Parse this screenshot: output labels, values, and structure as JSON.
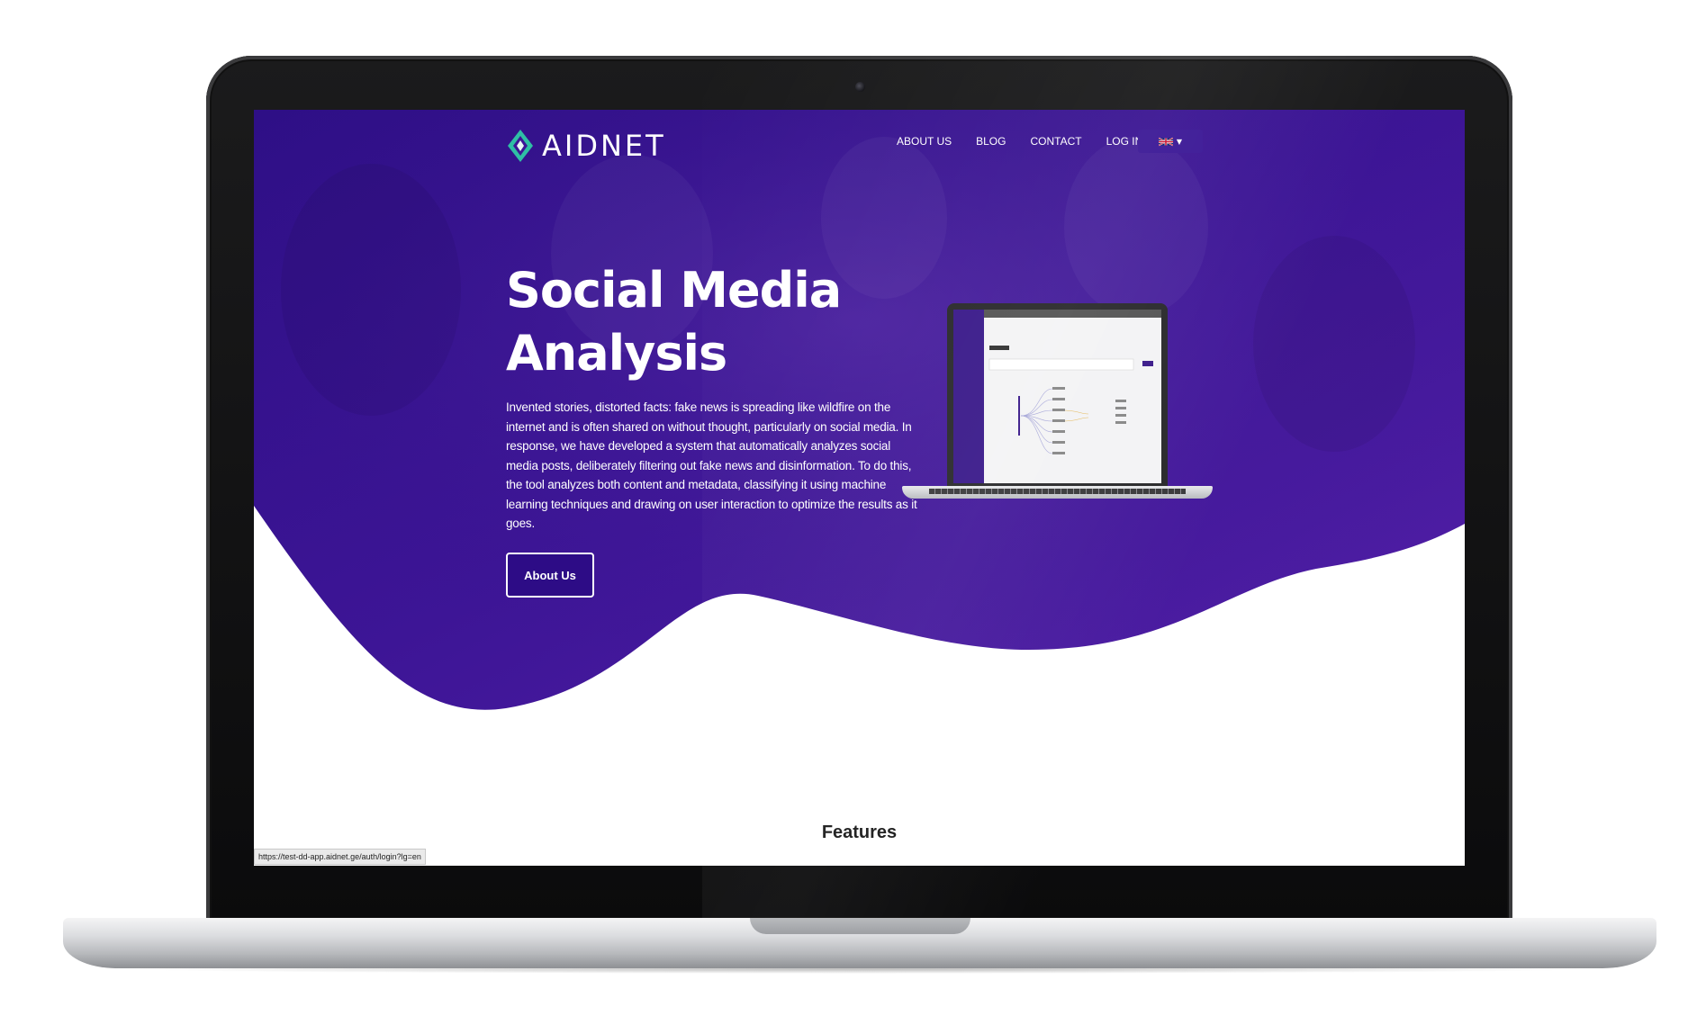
{
  "logo": {
    "text": "AIDNET",
    "icon": "aidnet-diamond-logo-icon"
  },
  "nav": {
    "items": [
      {
        "label": "ABOUT US"
      },
      {
        "label": "BLOG"
      },
      {
        "label": "CONTACT"
      },
      {
        "label": "LOG IN"
      }
    ],
    "language": {
      "icon": "uk-flag-icon",
      "caret": "chevron-down-icon"
    }
  },
  "hero": {
    "title": "Social Media Analysis",
    "description": "Invented stories, distorted facts: fake news is spreading like wildfire on the internet and is often shared on without thought, particularly on social media. In response, we have developed a system that automatically analyzes social media posts, deliberately filtering out fake news and disinformation. To do this, the tool analyzes both content and metadata, classifying it using machine learning techniques and drawing on user interaction to optimize the results as it goes.",
    "button_label": "About Us",
    "preview_image": "laptop-app-preview"
  },
  "features": {
    "title": "Features"
  },
  "status_bar": {
    "url": "https://test-dd-app.aidnet.ge/auth/login?lg=en"
  },
  "colors": {
    "hero_purple": "#4a1fa3",
    "hero_purple_dark": "#2d0c86",
    "text_light": "#ffffff",
    "text_dark": "#1a1a1a"
  }
}
